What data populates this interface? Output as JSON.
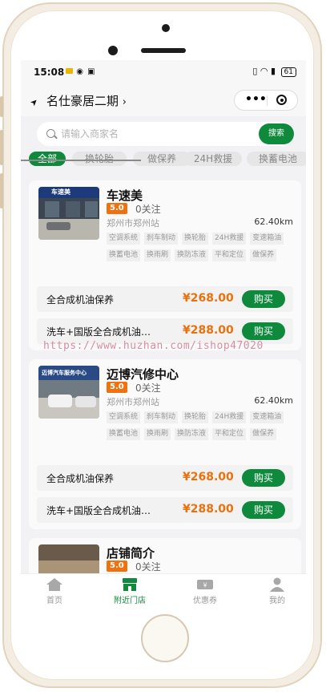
{
  "status_bar": {
    "time": "15:08",
    "battery": "61"
  },
  "location": {
    "name": "名仕豪居二期"
  },
  "search": {
    "placeholder": "请输入商家名",
    "button_label": "搜索"
  },
  "tabs": [
    "全部",
    "换轮胎",
    "做保养",
    "24H救援",
    "换蓄电池"
  ],
  "shops": [
    {
      "name": "车速美",
      "rating": "5.0",
      "follow": "0关注",
      "address": "郑州市郑州站",
      "distance": "62.40km",
      "tags": [
        "空调系统",
        "刹车制动",
        "换轮胎",
        "24H救援",
        "变速箱油",
        "换蓄电池",
        "换雨刷",
        "换防冻液",
        "平和定位",
        "做保养"
      ],
      "image_sign": "车速美",
      "services": [
        {
          "name": "全合成机油保养",
          "price": "¥268.00",
          "button": "购买"
        },
        {
          "name": "洗车+国版全合成机油…",
          "price": "¥288.00",
          "button": "购买"
        }
      ]
    },
    {
      "name": "迈博汽修中心",
      "rating": "5.0",
      "follow": "0关注",
      "address": "郑州市郑州站",
      "distance": "62.40km",
      "tags": [
        "空调系统",
        "刹车制动",
        "换轮胎",
        "24H救援",
        "变速箱油",
        "换蓄电池",
        "换雨刷",
        "换防冻液",
        "平和定位",
        "做保养"
      ],
      "image_sign": "迈博汽车服务中心",
      "services": [
        {
          "name": "全合成机油保养",
          "price": "¥268.00",
          "button": "购买"
        },
        {
          "name": "洗车+国版全合成机油…",
          "price": "¥288.00",
          "button": "购买"
        }
      ]
    },
    {
      "name": "店铺简介",
      "rating": "5.0",
      "follow": "0关注"
    }
  ],
  "watermark": "https://www.huzhan.com/ishop47020",
  "bottom_nav": [
    {
      "label": "首页",
      "icon": "home-icon"
    },
    {
      "label": "附近门店",
      "icon": "store-icon"
    },
    {
      "label": "优惠券",
      "icon": "coupon-icon"
    },
    {
      "label": "我的",
      "icon": "user-icon"
    }
  ],
  "colors": {
    "accent": "#0f8a3d",
    "price": "#e8720d",
    "rating": "#ee7210"
  }
}
